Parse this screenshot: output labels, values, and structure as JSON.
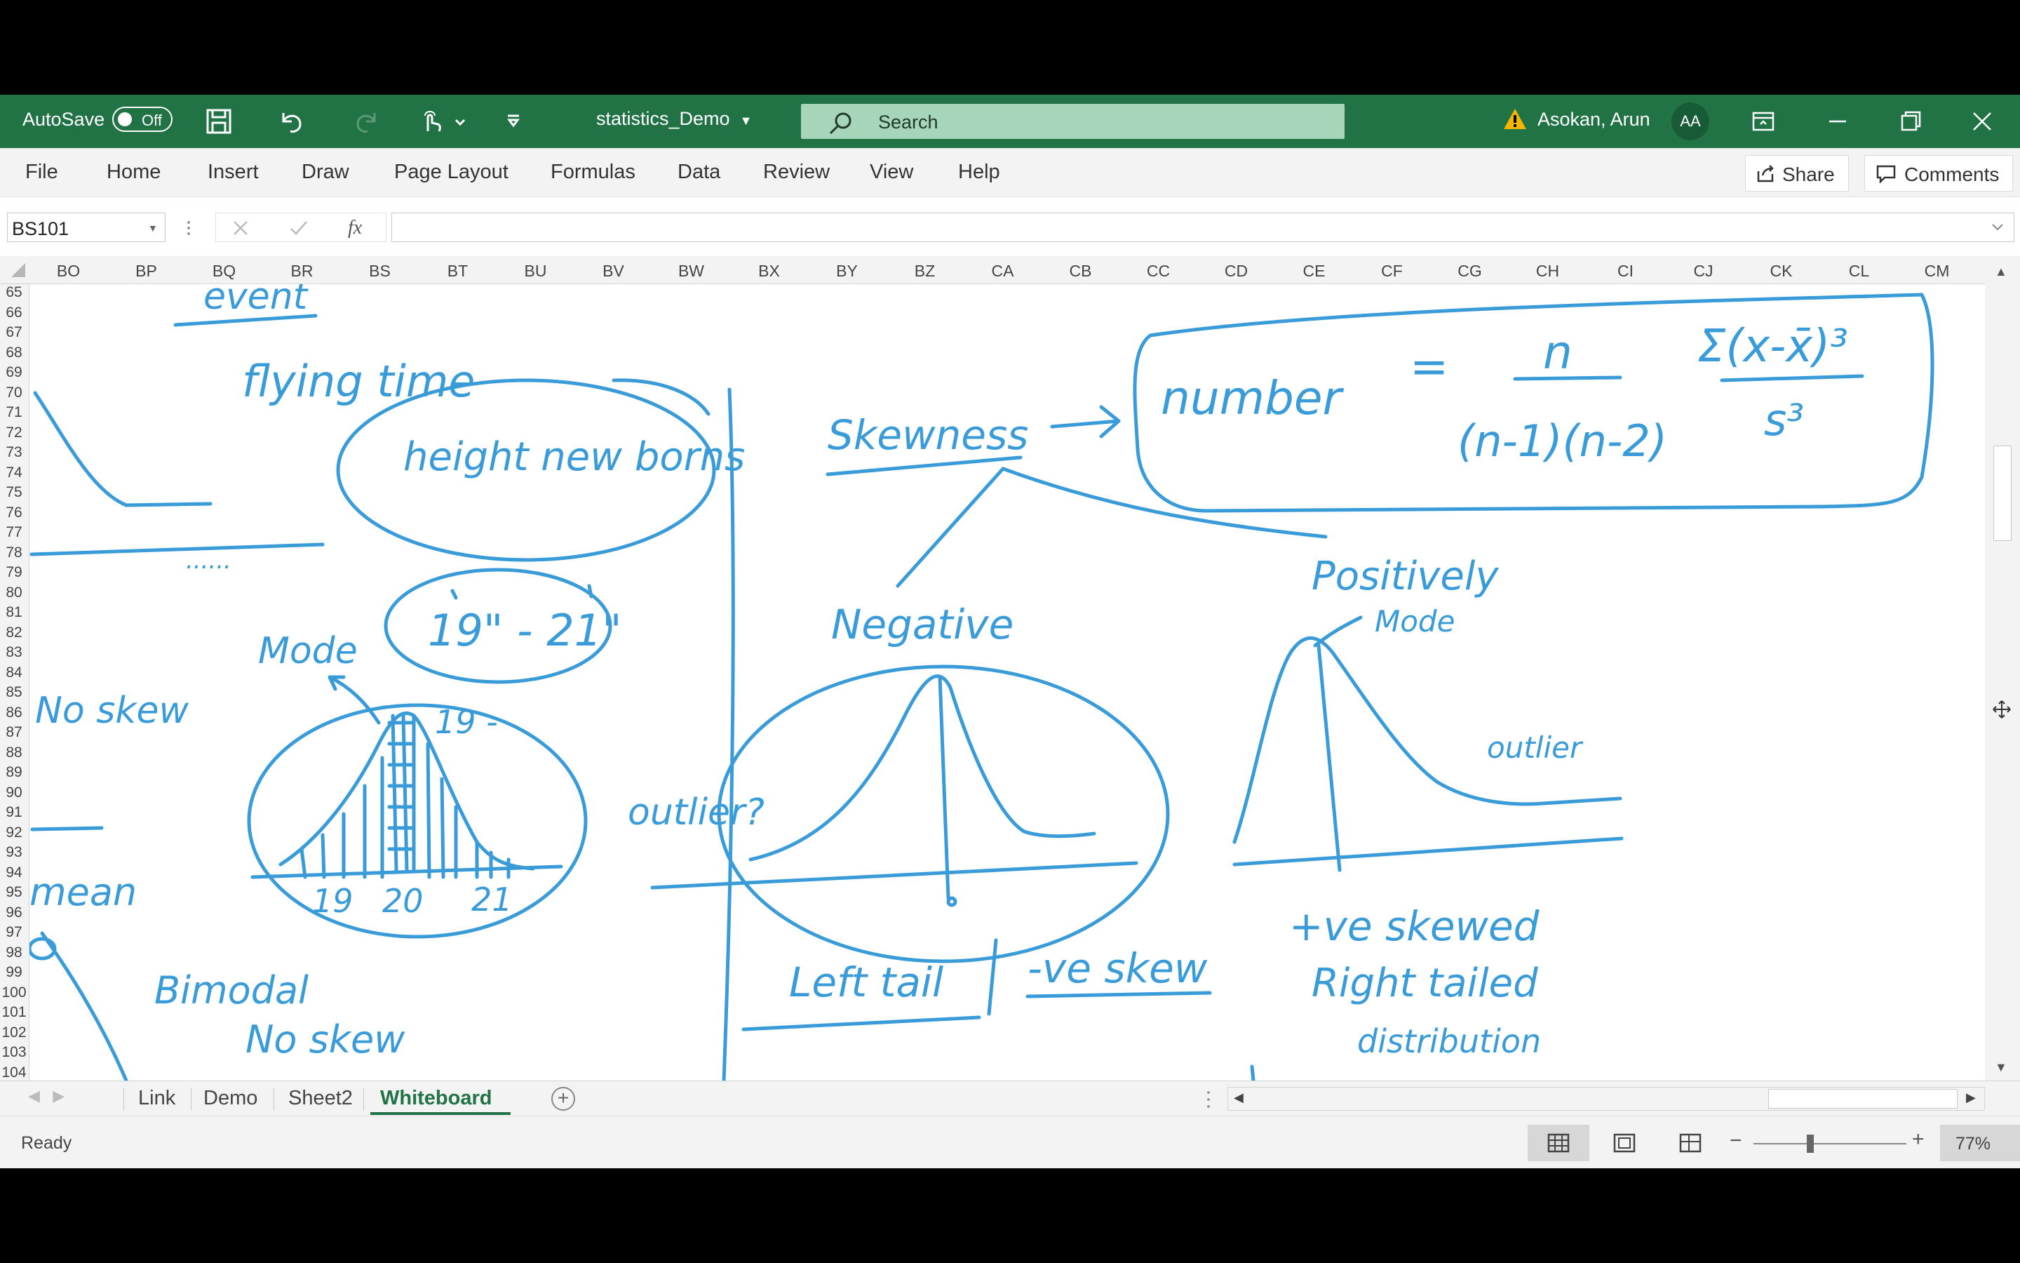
{
  "titlebar": {
    "autosave_label": "AutoSave",
    "autosave_state": "Off",
    "document_title": "statistics_Demo",
    "search_placeholder": "Search",
    "user_name": "Asokan, Arun",
    "user_initials": "AA",
    "accent": "#217346"
  },
  "ribbon": {
    "tabs": [
      "File",
      "Home",
      "Insert",
      "Draw",
      "Page Layout",
      "Formulas",
      "Data",
      "Review",
      "View",
      "Help"
    ],
    "share_label": "Share",
    "comments_label": "Comments"
  },
  "formula_bar": {
    "name_box": "BS101",
    "fx_label": "fx",
    "formula": ""
  },
  "grid": {
    "columns": [
      "BO",
      "BP",
      "BQ",
      "BR",
      "BS",
      "BT",
      "BU",
      "BV",
      "BW",
      "BX",
      "BY",
      "BZ",
      "CA",
      "CB",
      "CC",
      "CD",
      "CE",
      "CF",
      "CG",
      "CH",
      "CI",
      "CJ",
      "CK",
      "CL",
      "CM"
    ],
    "rows": [
      "65",
      "66",
      "67",
      "68",
      "69",
      "70",
      "71",
      "72",
      "73",
      "74",
      "75",
      "76",
      "77",
      "78",
      "79",
      "80",
      "81",
      "82",
      "83",
      "84",
      "85",
      "86",
      "87",
      "88",
      "89",
      "90",
      "91",
      "92",
      "93",
      "94",
      "95",
      "96",
      "97",
      "98",
      "99",
      "100",
      "101",
      "102",
      "103",
      "104"
    ]
  },
  "whiteboard": {
    "ink_color": "#3a9bd9",
    "notes": {
      "event": "event",
      "flying_time": "flying time",
      "height_newborns": "height new borns",
      "dots": "......",
      "mode_left": "Mode",
      "range": "19\" - 21\"",
      "no_skew_left": "No skew",
      "nineteen_dash": "19 -",
      "outlier": "outlier?",
      "axis_19": "19",
      "axis_20": "20",
      "axis_21": "21",
      "mean": "mean",
      "bimodal": "Bimodal",
      "no_skew_bottom": "No skew",
      "skewness": "Skewness",
      "formula_lhs": "number",
      "formula_eq": "=",
      "formula_n": "n",
      "formula_den": "(n-1)(n-2)",
      "formula_sum": "Σ(x-x̄)³",
      "formula_s3": "s³",
      "negative": "Negative",
      "left_tail": "Left tail",
      "neg_skew": "-ve skew",
      "positively": "Positively",
      "mode_right": "Mode",
      "outlier_right": "outlier",
      "pos_skewed": "+ve skewed",
      "right_tailed": "Right tailed",
      "distribution": "distribution"
    }
  },
  "sheet_tabs": {
    "tabs": [
      "Link",
      "Demo",
      "Sheet2",
      "Whiteboard"
    ],
    "active": "Whiteboard"
  },
  "statusbar": {
    "status": "Ready",
    "zoom": "77%"
  }
}
